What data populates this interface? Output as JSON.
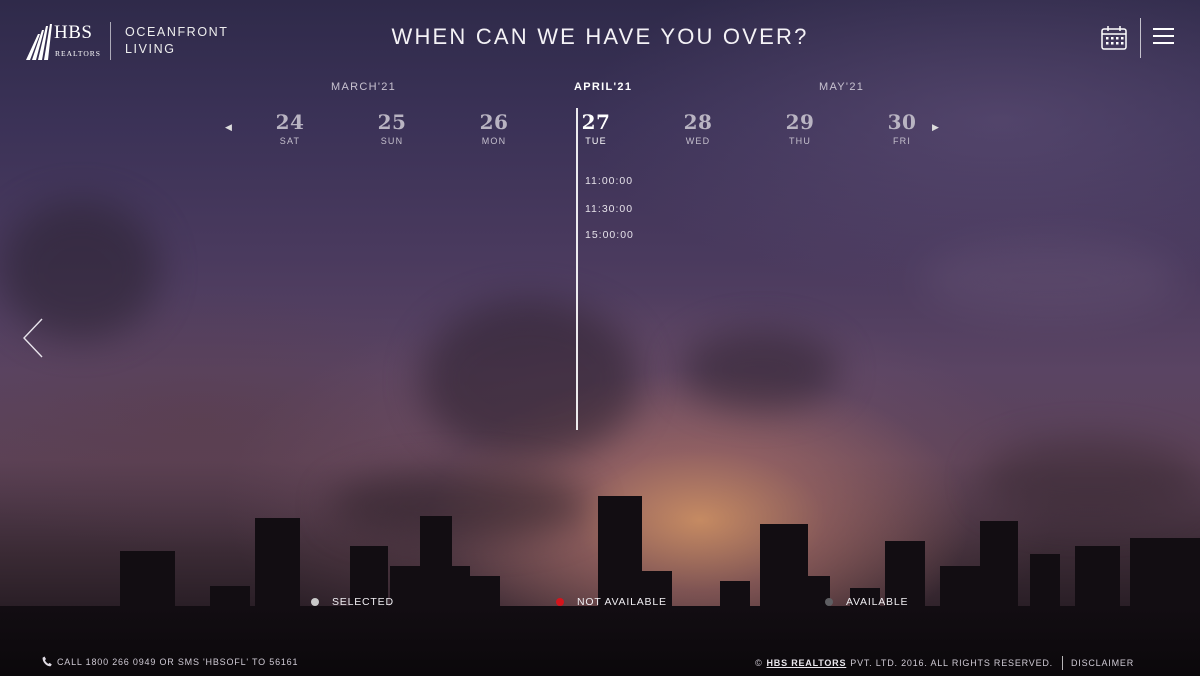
{
  "header": {
    "logo_main": "HBS",
    "logo_sub": "REALTORS",
    "project_line1": "OCEANFRONT",
    "project_line2": "LIVING",
    "title": "WHEN CAN WE HAVE YOU OVER?",
    "calendar_icon": "calendar-icon",
    "menu_icon": "hamburger-menu-icon"
  },
  "calendar": {
    "months": [
      {
        "label": "MARCH'21",
        "active": false
      },
      {
        "label": "APRIL'21",
        "active": true
      },
      {
        "label": "MAY'21",
        "active": false
      }
    ],
    "dates": [
      {
        "num": "24",
        "dow": "SAT"
      },
      {
        "num": "25",
        "dow": "SUN"
      },
      {
        "num": "26",
        "dow": "MON"
      },
      {
        "num": "27",
        "dow": "TUE",
        "selected": true
      },
      {
        "num": "28",
        "dow": "WED"
      },
      {
        "num": "29",
        "dow": "THU"
      },
      {
        "num": "30",
        "dow": "FRI"
      }
    ],
    "time_slots": [
      "11:00:00",
      "11:30:00",
      "15:00:00"
    ]
  },
  "legend": [
    {
      "label": "SELECTED",
      "color": "#c9c9c9"
    },
    {
      "label": "NOT AVAILABLE",
      "color": "#d4141c"
    },
    {
      "label": "AVAILABLE",
      "color": "#5e5e62"
    }
  ],
  "footer": {
    "contact": "CALL 1800 266 0949 OR SMS 'HBSOFL' TO 56161",
    "copyright_prefix": "©",
    "brand": "HBS REALTORS",
    "copyright_suffix": "PVT. LTD. 2016. ALL RIGHTS RESERVED.",
    "disclaimer": "DISCLAIMER"
  }
}
